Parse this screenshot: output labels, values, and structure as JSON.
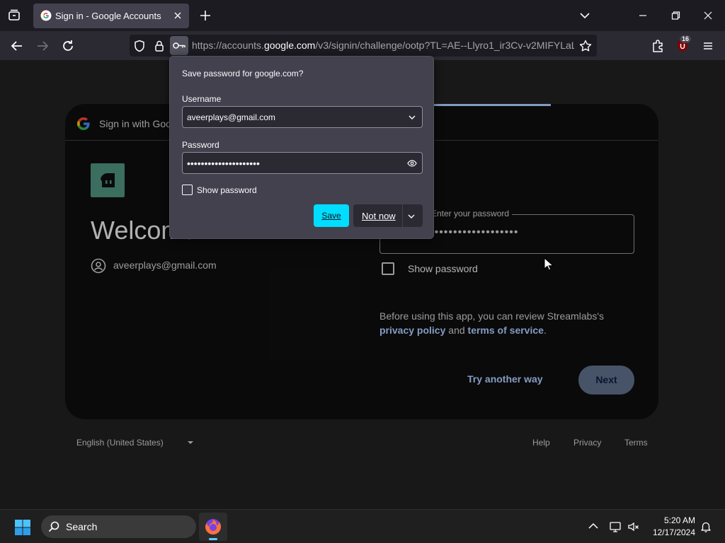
{
  "browser": {
    "tab_title": "Sign in - Google Accounts",
    "url_prefix": "https://accounts.",
    "url_domain": "google.com",
    "url_suffix": "/v3/signin/challenge/ootp?TL=AE--Llyro1_ir3Cv-v2MIFYLaL",
    "extensions_badge": "16"
  },
  "page": {
    "header_text": "Sign in with Google",
    "welcome": "Welcome",
    "account_email": "aveerplays@gmail.com",
    "password_legend": "Enter your password",
    "password_dots": "•••••••••••••••••••",
    "show_password": "Show password",
    "review_prefix": "Before using this app, you can review Streamlabs's",
    "privacy_policy": "privacy policy",
    "and": "and",
    "terms_of_service": "terms of service",
    "period": ".",
    "try_another": "Try another way",
    "next": "Next",
    "footer": {
      "language": "English (United States)",
      "help": "Help",
      "privacy": "Privacy",
      "terms": "Terms"
    }
  },
  "save_popup": {
    "title": "Save password for google.com?",
    "username_label": "Username",
    "username_value": "aveerplays@gmail.com",
    "password_label": "Password",
    "password_value": "•••••••••••••••••••••",
    "show_password": "Show password",
    "save": "Save",
    "not_now": "Not now"
  },
  "taskbar": {
    "search": "Search",
    "time": "5:20 AM",
    "date": "12/17/2024"
  },
  "colors": {
    "accent_save": "#00ddff",
    "link_blue": "#a8c7fa",
    "chrome_dark": "#1c1b22",
    "popup_bg": "#42414d"
  }
}
